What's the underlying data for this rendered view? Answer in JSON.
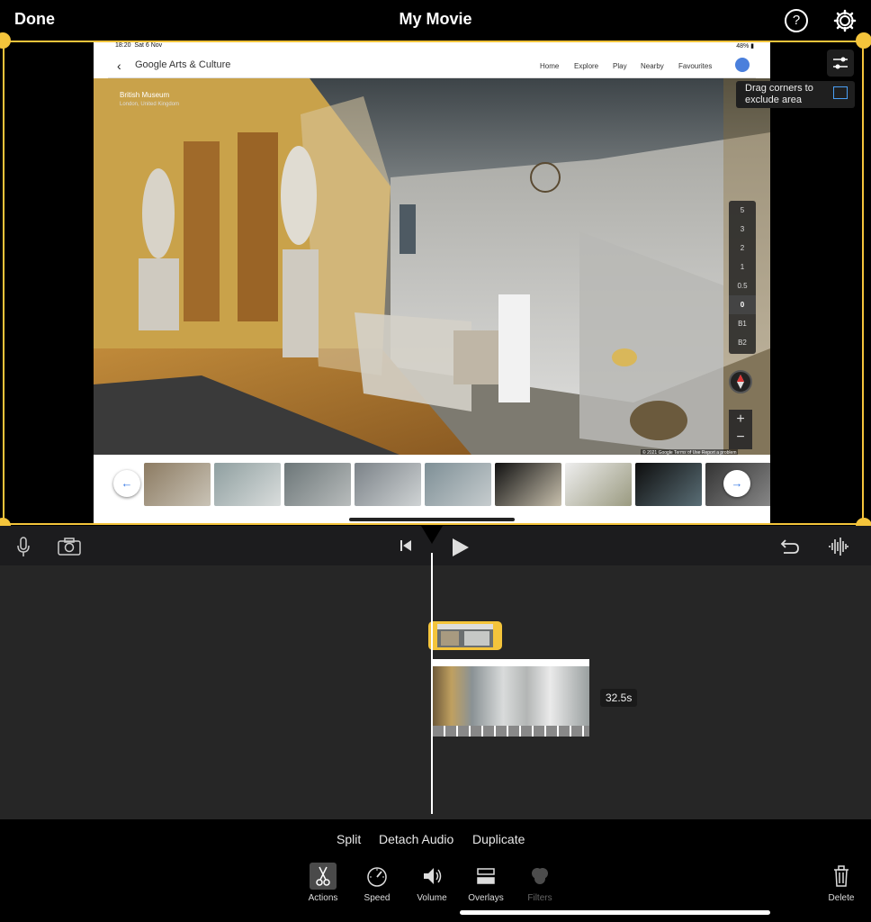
{
  "header": {
    "done_label": "Done",
    "title": "My Movie"
  },
  "preview": {
    "crop_hint": "Drag corners to exclude area",
    "screenshot": {
      "status_time": "18:20",
      "status_date": "Sat 6 Nov",
      "battery": "48%",
      "logo_text": "Google Arts & Culture",
      "nav_items": [
        "Home",
        "Explore",
        "Play",
        "Nearby",
        "Favourites"
      ],
      "place_title": "British Museum",
      "place_subtitle": "London, United Kingdom",
      "floors": [
        "5",
        "3",
        "2",
        "1",
        "0.5",
        "0",
        "B1",
        "B2"
      ],
      "copyright": "© 2021 Google   Terms of Use   Report a problem"
    }
  },
  "timeline": {
    "duration_label": "32.5s"
  },
  "bottom": {
    "actions": [
      "Split",
      "Detach Audio",
      "Duplicate"
    ],
    "tools": [
      {
        "label": "Actions",
        "icon": "scissors-icon"
      },
      {
        "label": "Speed",
        "icon": "gauge-icon"
      },
      {
        "label": "Volume",
        "icon": "speaker-icon"
      },
      {
        "label": "Overlays",
        "icon": "overlays-icon"
      },
      {
        "label": "Filters",
        "icon": "filters-icon"
      }
    ],
    "delete_label": "Delete"
  },
  "colors": {
    "accent": "#f4c43b",
    "link": "#3578e5"
  }
}
